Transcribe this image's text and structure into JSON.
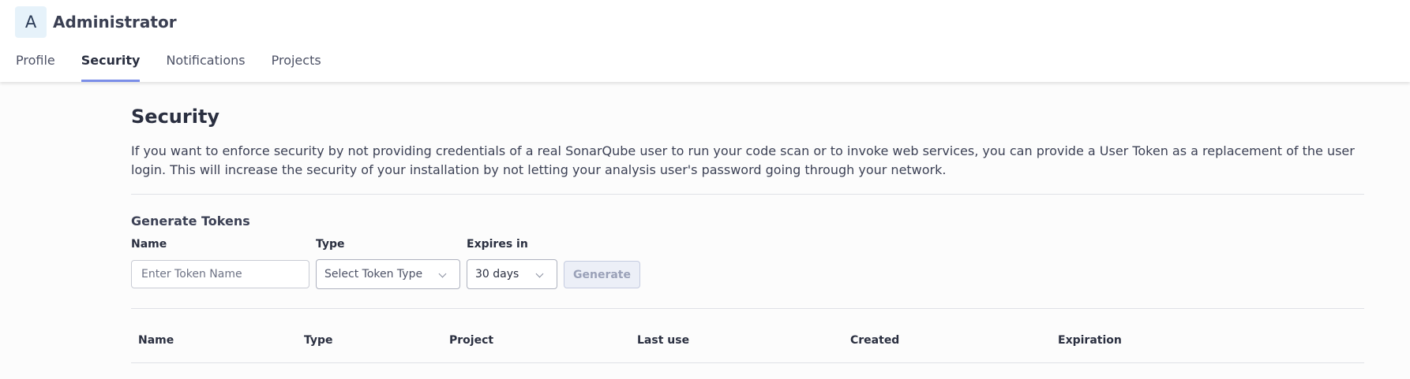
{
  "user": {
    "avatar_initial": "A",
    "name": "Administrator"
  },
  "tabs": [
    {
      "label": "Profile",
      "active": false
    },
    {
      "label": "Security",
      "active": true
    },
    {
      "label": "Notifications",
      "active": false
    },
    {
      "label": "Projects",
      "active": false
    }
  ],
  "security": {
    "title": "Security",
    "description": "If you want to enforce security by not providing credentials of a real SonarQube user to run your code scan or to invoke web services, you can provide a User Token as a replacement of the user login. This will increase the security of your installation by not letting your analysis user's password going through your network."
  },
  "generate": {
    "title": "Generate Tokens",
    "name_label": "Name",
    "name_placeholder": "Enter Token Name",
    "name_value": "",
    "type_label": "Type",
    "type_placeholder": "Select Token Type",
    "expires_label": "Expires in",
    "expires_value": "30 days",
    "button_label": "Generate"
  },
  "table": {
    "columns": [
      "Name",
      "Type",
      "Project",
      "Last use",
      "Created",
      "Expiration"
    ]
  },
  "colors": {
    "accent": "#7b8ee8",
    "avatar_bg": "#e6f2fa",
    "button_disabled_bg": "#eceff7"
  }
}
